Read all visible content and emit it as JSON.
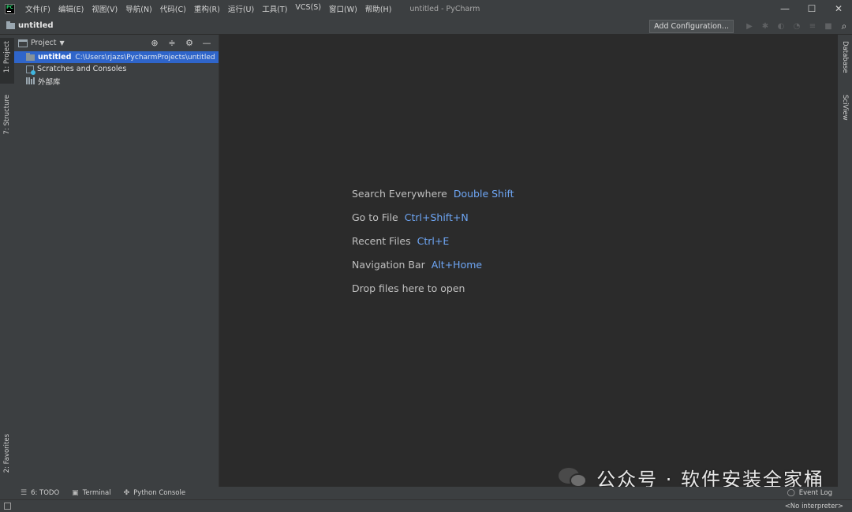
{
  "titlebar": {
    "menu": [
      "文件(F)",
      "编辑(E)",
      "视图(V)",
      "导航(N)",
      "代码(C)",
      "重构(R)",
      "运行(U)",
      "工具(T)",
      "VCS(S)",
      "窗口(W)",
      "帮助(H)"
    ],
    "window_title": "untitled - PyCharm",
    "controls": {
      "minimize": "—",
      "maximize": "☐",
      "close": "✕"
    }
  },
  "navbar": {
    "project_name": "untitled",
    "add_configuration": "Add Configuration...",
    "icons": [
      "run-icon",
      "debug-icon",
      "coverage-icon",
      "profile-icon",
      "concurrency-icon",
      "stop-icon",
      "search-icon"
    ]
  },
  "left_stripe": {
    "project_tab": "1: Project",
    "structure_tab": "7: Structure",
    "favorites_tab": "2: Favorites"
  },
  "right_stripe": {
    "database_tab": "Database",
    "sciview_tab": "SciView"
  },
  "project_panel": {
    "title": "Project",
    "tree": [
      {
        "name": "untitled",
        "path": "C:\\Users\\rjazs\\PycharmProjects\\untitled"
      },
      {
        "name": "Scratches and Consoles"
      },
      {
        "name": "外部库"
      }
    ]
  },
  "editor": {
    "hints": [
      {
        "label": "Search Everywhere",
        "key": "Double Shift"
      },
      {
        "label": "Go to File",
        "key": "Ctrl+Shift+N"
      },
      {
        "label": "Recent Files",
        "key": "Ctrl+E"
      },
      {
        "label": "Navigation Bar",
        "key": "Alt+Home"
      },
      {
        "label": "Drop files here to open",
        "key": ""
      }
    ]
  },
  "watermark": {
    "text": "公众号 · 软件安装全家桶"
  },
  "bottom_bar": {
    "todo": "6: TODO",
    "terminal": "Terminal",
    "python_console": "Python Console",
    "event_log": "Event Log"
  },
  "status_bar": {
    "interpreter": "<No interpreter>"
  },
  "colors": {
    "editor_bg": "#2b2b2b",
    "panel_bg": "#3c3f41",
    "selection": "#2f65ca",
    "shortcut": "#6ea6f5"
  }
}
